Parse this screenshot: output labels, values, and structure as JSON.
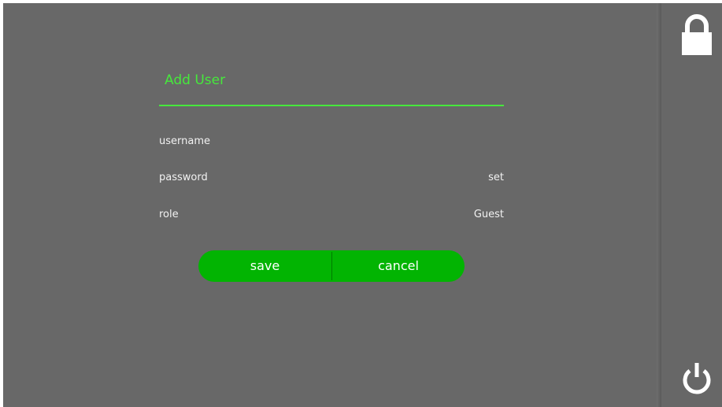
{
  "dialog": {
    "title": "Add User",
    "fields": {
      "username": {
        "label": "username",
        "value": ""
      },
      "password": {
        "label": "password",
        "value": "set"
      },
      "role": {
        "label": "role",
        "value": "Guest"
      }
    },
    "buttons": {
      "save_label": "save",
      "cancel_label": "cancel"
    }
  },
  "sidebar": {
    "top_icon": "lock-icon",
    "bottom_icon": "power-icon"
  },
  "colors": {
    "background": "#686868",
    "accent": "#46e83c",
    "button": "#02b402",
    "text": "#f2f2f2"
  }
}
